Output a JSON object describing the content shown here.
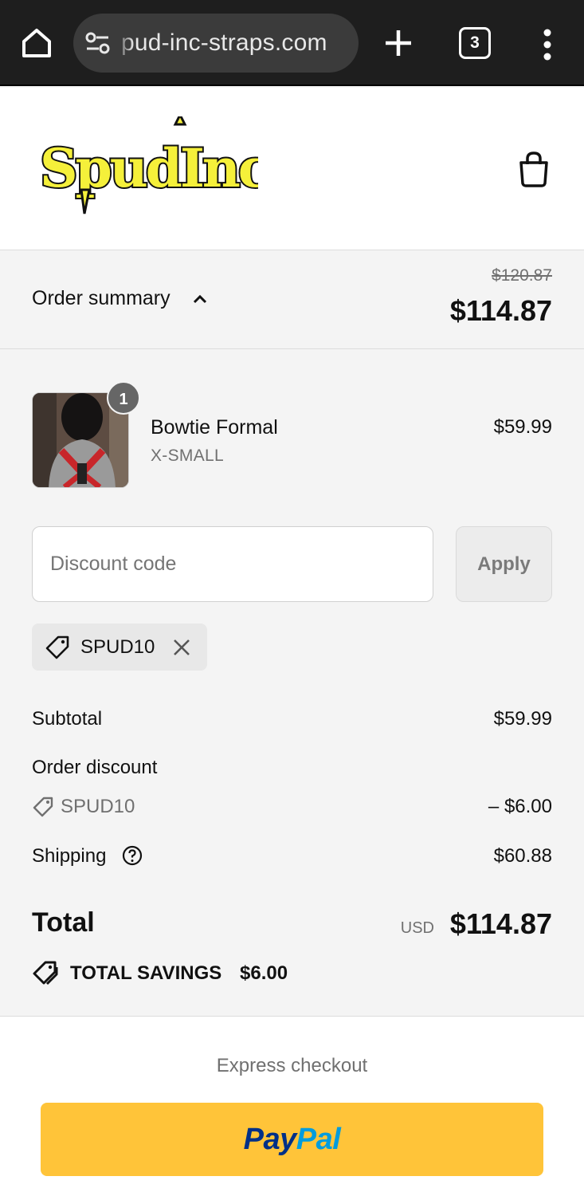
{
  "browser": {
    "url": "pud-inc-straps.com",
    "tab_count": "3"
  },
  "header": {
    "logo_text": "SpudInc"
  },
  "summary": {
    "label": "Order summary",
    "original_total": "$120.87",
    "total": "$114.87"
  },
  "product": {
    "quantity": "1",
    "name": "Bowtie Formal",
    "variant": "X-SMALL",
    "price": "$59.99"
  },
  "discount": {
    "placeholder": "Discount code",
    "apply_label": "Apply",
    "applied_code": "SPUD10"
  },
  "totals": {
    "subtotal_label": "Subtotal",
    "subtotal_value": "$59.99",
    "order_discount_label": "Order discount",
    "discount_code": "SPUD10",
    "discount_value": "– $6.00",
    "shipping_label": "Shipping",
    "shipping_value": "$60.88",
    "total_label": "Total",
    "currency": "USD",
    "total_value": "$114.87",
    "savings_label": "TOTAL SAVINGS",
    "savings_value": "$6.00"
  },
  "express": {
    "label": "Express checkout",
    "paypal_part1": "Pay",
    "paypal_part2": "Pal"
  },
  "colors": {
    "logo_yellow": "#f5f03a",
    "paypal_button": "#ffc439",
    "paypal_dark": "#003087",
    "paypal_light": "#009cde",
    "badge_gray": "#666666"
  },
  "icons": [
    "home-icon",
    "site-settings-icon",
    "new-tab-icon",
    "tab-switcher-icon",
    "more-menu-icon",
    "shopping-bag-icon",
    "chevron-up-icon",
    "tag-icon",
    "close-icon",
    "help-icon",
    "savings-tag-icon"
  ]
}
